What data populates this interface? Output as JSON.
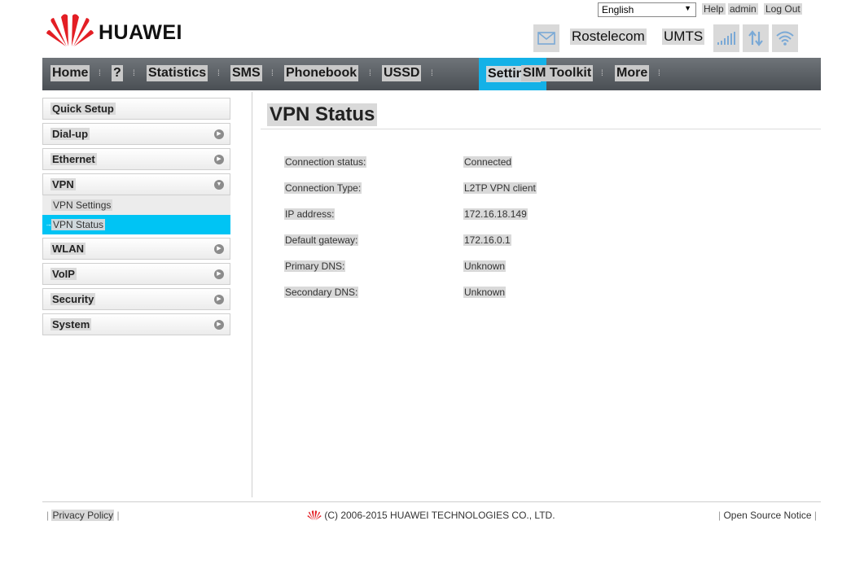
{
  "header": {
    "brand": "HUAWEI",
    "language": "English",
    "help": "Help",
    "user": "admin",
    "logout": "Log Out",
    "operator": "Rostelecom",
    "network_type": "UMTS"
  },
  "nav": {
    "home": "Home",
    "help": "?",
    "statistics": "Statistics",
    "sms": "SMS",
    "phonebook": "Phonebook",
    "ussd": "USSD",
    "settings": "Settings",
    "sim_toolkit": "SIM Toolkit",
    "more": "More",
    "active": "Settings"
  },
  "sidebar": {
    "quick_setup": "Quick Setup",
    "dialup": "Dial-up",
    "ethernet": "Ethernet",
    "vpn": "VPN",
    "vpn_settings": "VPN Settings",
    "vpn_status": "VPN Status",
    "wlan": "WLAN",
    "voip": "VoIP",
    "security": "Security",
    "system": "System"
  },
  "main": {
    "title": "VPN Status",
    "rows": [
      {
        "label": "Connection status:",
        "value": "Connected"
      },
      {
        "label": "Connection Type:",
        "value": "L2TP VPN client"
      },
      {
        "label": "IP address:",
        "value": "172.16.18.149"
      },
      {
        "label": "Default gateway:",
        "value": "172.16.0.1"
      },
      {
        "label": "Primary DNS:",
        "value": "Unknown"
      },
      {
        "label": "Secondary DNS:",
        "value": "Unknown"
      }
    ]
  },
  "footer": {
    "privacy": "Privacy Policy",
    "copyright": "(C) 2006-2015 HUAWEI TECHNOLOGIES CO., LTD.",
    "open_source": "Open Source Notice"
  },
  "colors": {
    "accent": "#14b1e7",
    "submenu_active": "#00c4f4",
    "logo_red": "#e31e24",
    "icon_blue": "#7aa9d6"
  },
  "icons": [
    "huawei-logo-icon",
    "envelope-icon",
    "signal-icon",
    "data-transfer-icon",
    "wifi-icon",
    "chevron-right-icon",
    "chevron-down-icon",
    "arrow-icon"
  ]
}
